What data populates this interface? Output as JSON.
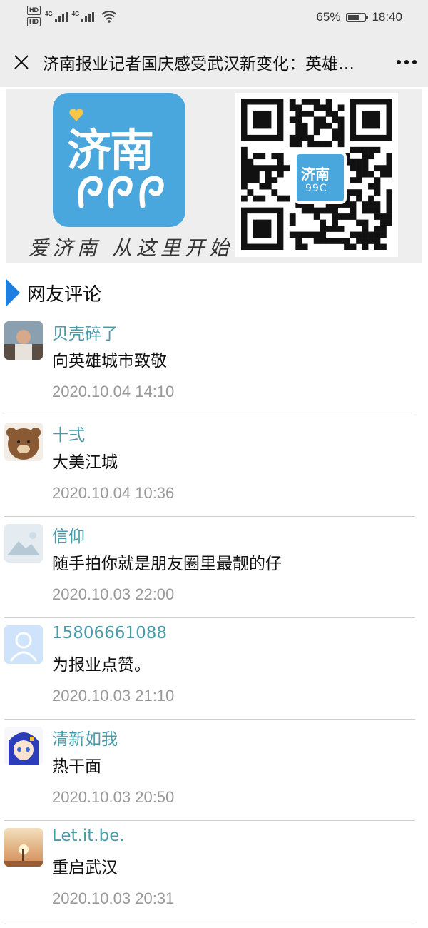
{
  "status_bar": {
    "hd1": "HD",
    "hd2": "HD",
    "net1": "4G",
    "net2": "4G",
    "battery_percent": "65%",
    "battery_level": 0.65,
    "time": "18:40",
    "icons": [
      "signal-icon",
      "wifi-icon",
      "battery-icon"
    ]
  },
  "title_bar": {
    "title": "济南报业记者国庆感受武汉新变化：英雄…",
    "icons": [
      "close-icon",
      "more-icon"
    ]
  },
  "banner": {
    "logo_text": "济南",
    "logo_sub": "99C",
    "slogan": "爱济南 从这里开始",
    "qr_logo_text": "济南",
    "qr_logo_sub": "99C"
  },
  "section": {
    "title": "网友评论"
  },
  "comments": [
    {
      "name": "贝壳碎了",
      "text": "向英雄城市致敬",
      "time": "2020.10.04 14:10",
      "avatar": "person-photo"
    },
    {
      "name": "十弍",
      "text": "大美江城",
      "time": "2020.10.04 10:36",
      "avatar": "bear"
    },
    {
      "name": "信仰",
      "text": "随手拍你就是朋友圈里最靓的仔",
      "time": "2020.10.03 22:00",
      "avatar": "landscape-placeholder"
    },
    {
      "name": "15806661088",
      "text": "为报业点赞。",
      "time": "2020.10.03 21:10",
      "avatar": "default-user"
    },
    {
      "name": "清新如我",
      "text": "热干面",
      "time": "2020.10.03 20:50",
      "avatar": "anime-girl"
    },
    {
      "name": "Let.it.be.",
      "text": "重启武汉",
      "time": "2020.10.03 20:31",
      "avatar": "sunset"
    }
  ],
  "colors": {
    "accent": "#1e7fe0",
    "name": "#4a9ba8",
    "logo": "#4aa7de"
  }
}
